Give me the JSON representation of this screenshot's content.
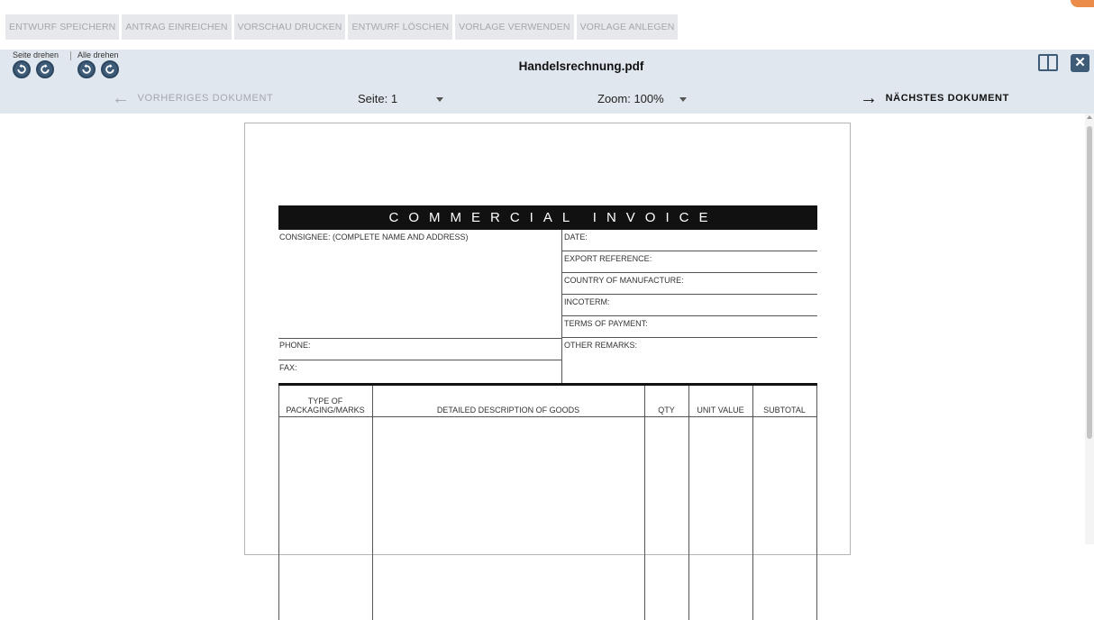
{
  "toolbar": {
    "buttons": [
      "ENTWURF SPEICHERN",
      "ANTRAG EINREICHEN",
      "VORSCHAU DRUCKEN",
      "ENTWURF LÖSCHEN",
      "VORLAGE VERWENDEN",
      "VORLAGE ANLEGEN"
    ]
  },
  "viewer": {
    "rotate_page_label": "Seite drehen",
    "rotate_all_label": "Alle drehen",
    "file_name": "Handelsrechnung.pdf",
    "prev_document": "VORHERIGES DOKUMENT",
    "next_document": "NÄCHSTES DOKUMENT",
    "page_label": "Seite: 1",
    "zoom_label": "Zoom: 100%",
    "icons": {
      "rotate_left": "rotate-left-icon",
      "rotate_right": "rotate-right-icon",
      "layout": "split-view-icon",
      "close": "close-icon",
      "prev": "arrow-left-icon",
      "next": "arrow-right-icon"
    }
  },
  "invoice": {
    "title": "COMMERCIAL INVOICE",
    "consignee": "CONSIGNEE: (COMPLETE NAME AND ADDRESS)",
    "phone": "PHONE:",
    "fax": "FAX:",
    "fields": [
      "DATE:",
      "EXPORT REFERENCE:",
      "COUNTRY OF MANUFACTURE:",
      "INCOTERM:",
      "TERMS OF PAYMENT:",
      "OTHER REMARKS:"
    ],
    "columns": [
      "TYPE OF PACKAGING/MARKS",
      "DETAILED DESCRIPTION OF GOODS",
      "QTY",
      "UNIT VALUE",
      "SUBTOTAL"
    ]
  }
}
